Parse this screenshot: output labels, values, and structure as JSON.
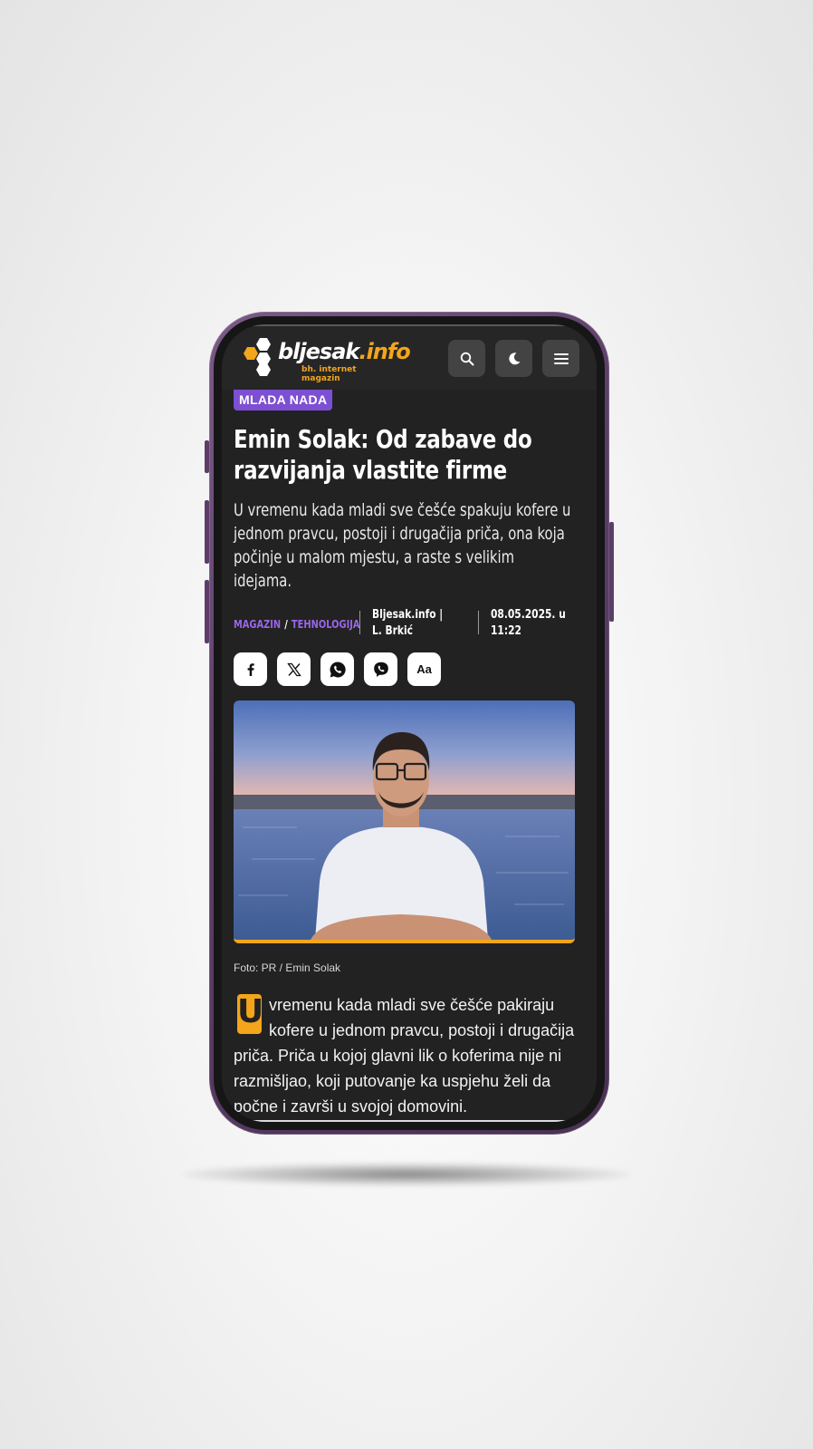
{
  "header": {
    "logo_main": "bljesak",
    "logo_accent": ".info",
    "logo_tagline": "bh. internet magazin",
    "icons": [
      "search-icon",
      "moon-icon",
      "menu-icon"
    ]
  },
  "article": {
    "tag": "MLADA NADA",
    "title": "Emin Solak: Od zabave do razvijanja vlastite firme",
    "lead": "U vremenu kada mladi sve češće spakuju kofere u jednom pravcu, postoji i drugačija priča, ona koja počinje u malom mjestu, a raste s velikim idejama.",
    "categories": [
      "MAGAZIN",
      "TEHNOLOGIJA"
    ],
    "category_separator": "/",
    "author": "Bljesak.info | L. Brkić",
    "date": "08.05.2025. u 11:22",
    "share_buttons": [
      "facebook-icon",
      "x-icon",
      "whatsapp-icon",
      "viber-icon"
    ],
    "font_size_label": "Aa",
    "photo_caption": "Foto: PR / Emin Solak",
    "body_dropcap": "U",
    "body_text": "vremenu kada mladi sve češće pakiraju kofere u jednom pravcu, postoji i drugačija priča. Priča u kojoj glavni lik o koferima nije ni razmišljao, koji putovanje ka uspjehu želi da počne i završi u svojoj domovini."
  },
  "colors": {
    "accent_orange": "#f3a51b",
    "accent_purple": "#7c4fd3",
    "background_dark": "#222222",
    "phone_frame": "#5c3f68"
  }
}
